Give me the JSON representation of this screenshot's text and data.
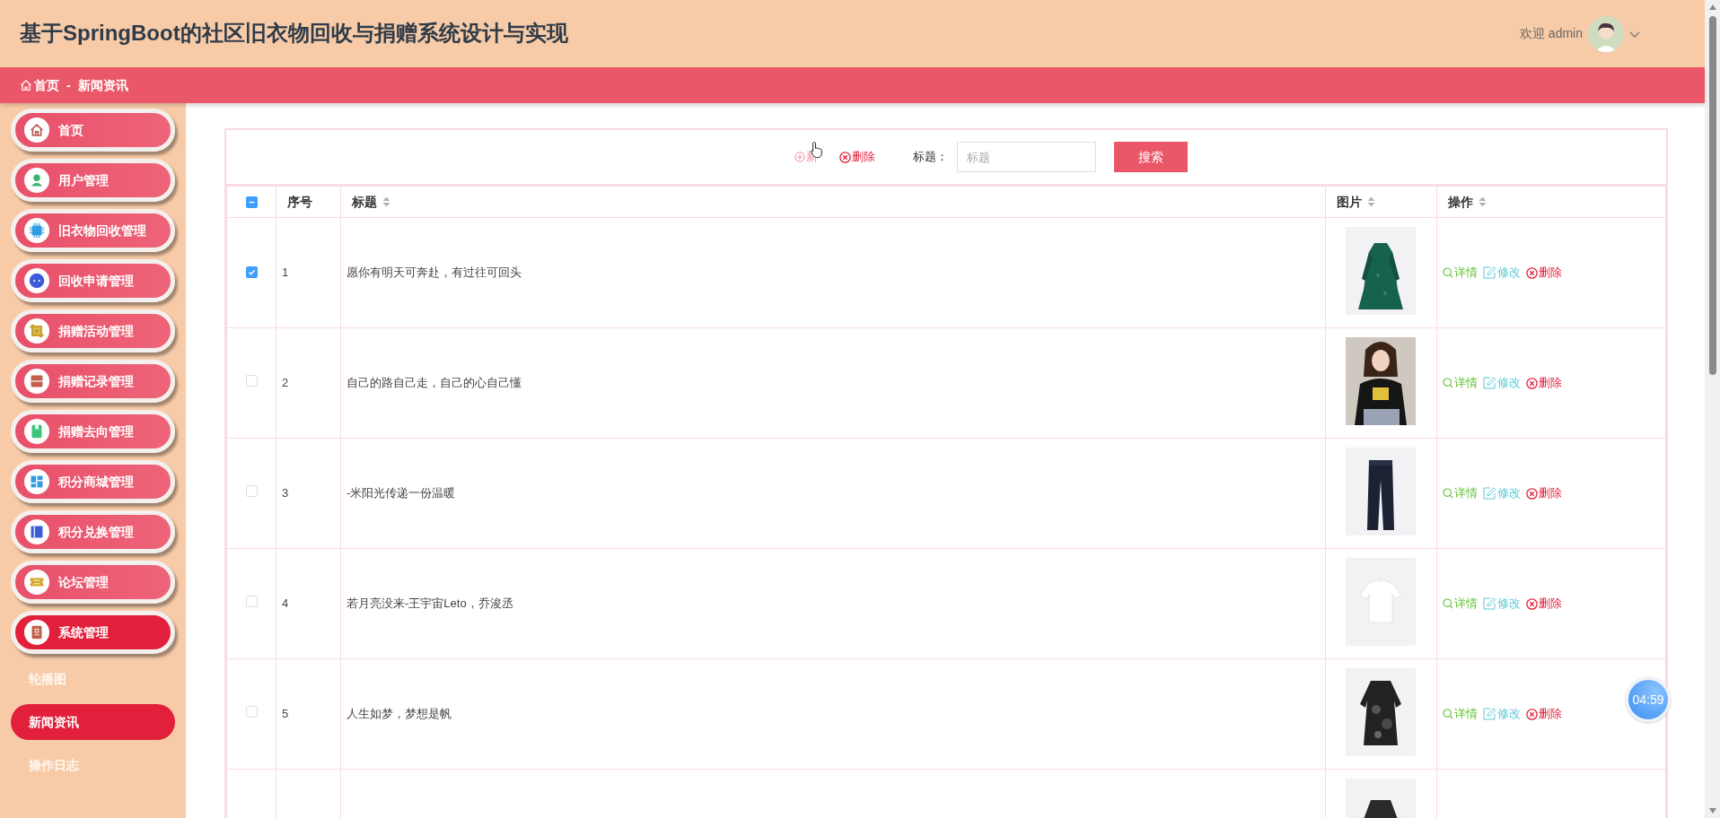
{
  "header": {
    "title": "基于SpringBoot的社区旧衣物回收与捐赠系统设计与实现",
    "welcome": "欢迎 admin"
  },
  "breadcrumb": {
    "items": [
      {
        "label": "首页"
      },
      {
        "label": "新闻资讯"
      }
    ],
    "separator": "-"
  },
  "sidebar": {
    "items": [
      {
        "label": "首页",
        "expanded": false
      },
      {
        "label": "用户管理",
        "expanded": false
      },
      {
        "label": "旧衣物回收管理",
        "expanded": false
      },
      {
        "label": "回收申请管理",
        "expanded": false
      },
      {
        "label": "捐赠活动管理",
        "expanded": false
      },
      {
        "label": "捐赠记录管理",
        "expanded": false
      },
      {
        "label": "捐赠去向管理",
        "expanded": false
      },
      {
        "label": "积分商城管理",
        "expanded": false
      },
      {
        "label": "积分兑换管理",
        "expanded": false
      },
      {
        "label": "论坛管理",
        "expanded": false
      },
      {
        "label": "系统管理",
        "expanded": true,
        "children": [
          {
            "label": "轮播图",
            "selected": false
          },
          {
            "label": "新闻资讯",
            "selected": true
          },
          {
            "label": "操作日志",
            "selected": false
          }
        ]
      }
    ]
  },
  "toolbar": {
    "add_label": "新",
    "delete_label": "删除",
    "search_label": "标题：",
    "search": {
      "placeholder": "标题"
    },
    "search_button": "搜索"
  },
  "table": {
    "select_all": {
      "indeterminate": true
    },
    "columns": [
      {
        "label": "序号",
        "sortable": false
      },
      {
        "label": "标题",
        "sortable": true
      },
      {
        "label": "图片",
        "sortable": true
      },
      {
        "label": "操作",
        "sortable": true
      }
    ],
    "rows": [
      {
        "index": "1",
        "title": "愿你有明天可奔赴，有过往可回头",
        "checked": true,
        "picture": {
          "kind": "picture"
        },
        "actions": [
          {
            "kind": "view",
            "label": "详情"
          },
          {
            "kind": "edit",
            "label": "修改"
          },
          {
            "kind": "delete",
            "label": "删除"
          }
        ]
      },
      {
        "index": "2",
        "title": "自己的路自己走，自己的心自己懂",
        "checked": false,
        "picture": {
          "kind": "picture"
        },
        "actions": [
          {
            "kind": "view",
            "label": "详情"
          },
          {
            "kind": "edit",
            "label": "修改"
          },
          {
            "kind": "delete",
            "label": "删除"
          }
        ]
      },
      {
        "index": "3",
        "title": "-米阳光传递一份温暖",
        "checked": false,
        "picture": {
          "kind": "picture"
        },
        "actions": [
          {
            "kind": "view",
            "label": "详情"
          },
          {
            "kind": "edit",
            "label": "修改"
          },
          {
            "kind": "delete",
            "label": "删除"
          }
        ]
      },
      {
        "index": "4",
        "title": "若月亮没来-王宇宙Leto，乔浚丞",
        "checked": false,
        "picture": {
          "kind": "picture"
        },
        "actions": [
          {
            "kind": "view",
            "label": "详情"
          },
          {
            "kind": "edit",
            "label": "修改"
          },
          {
            "kind": "delete",
            "label": "删除"
          }
        ]
      },
      {
        "index": "5",
        "title": "人生如梦，梦想是帆",
        "checked": false,
        "picture": {
          "kind": "picture"
        },
        "actions": [
          {
            "kind": "view",
            "label": "详情"
          },
          {
            "kind": "edit",
            "label": "修改"
          },
          {
            "kind": "delete",
            "label": "删除"
          }
        ]
      }
    ],
    "partial_row": {
      "picture": {
        "kind": "picture"
      }
    }
  },
  "timer": "04:59"
}
